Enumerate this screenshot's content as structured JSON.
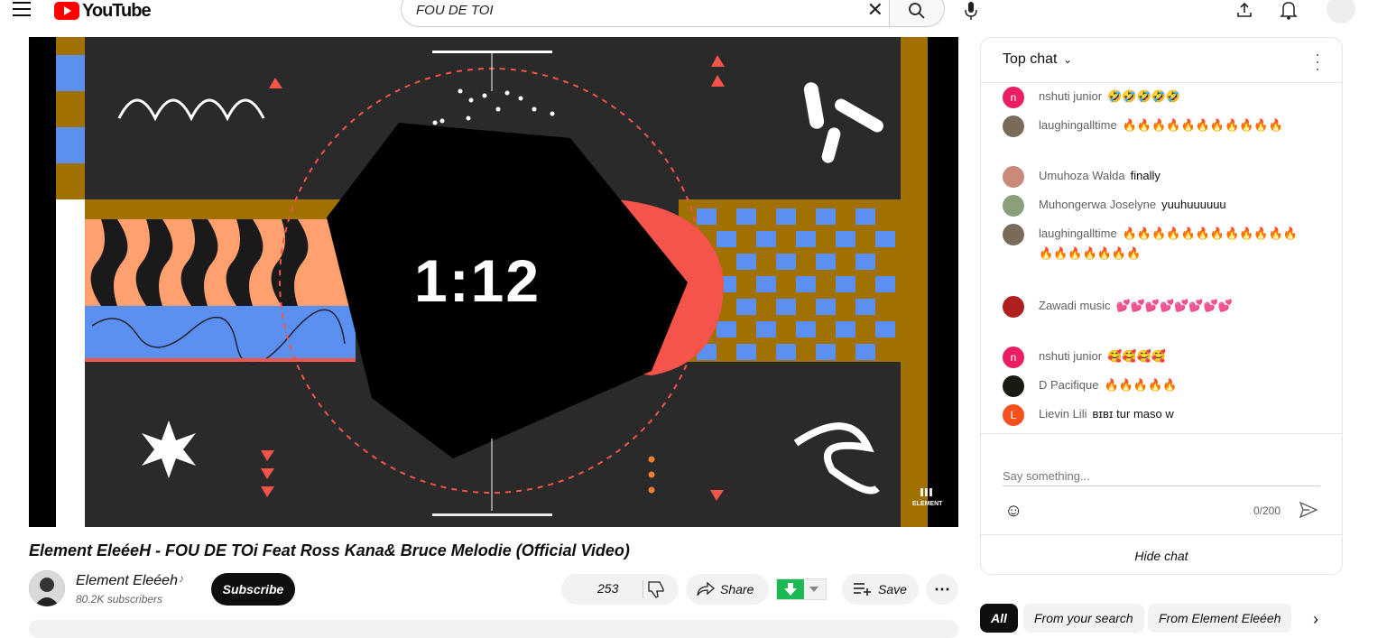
{
  "header": {
    "logo_text": "YouTube",
    "search_value": "FOU DE TOI"
  },
  "video": {
    "overlay_time": "1:12",
    "watermark": "ELEMENT",
    "title": "Element EleéeH - FOU DE TOi Feat Ross Kana& Bruce Melodie (Official Video)"
  },
  "channel": {
    "name": "Element Eleéeh",
    "subscribers": "80.2K subscribers",
    "subscribe_label": "Subscribe"
  },
  "actions": {
    "like_count": "253",
    "share_label": "Share",
    "save_label": "Save"
  },
  "chat": {
    "mode_label": "Top chat",
    "messages": [
      {
        "author": "nshuti junior",
        "text": "🤣🤣🤣🤣🤣",
        "avatar": "n",
        "color": "#e91e63"
      },
      {
        "author": "laughingalltime",
        "text": "🔥🔥🔥🔥🔥🔥🔥🔥🔥🔥🔥",
        "avatar": "",
        "color": "#7a6a5a"
      },
      {
        "author": "Umuhoza Walda",
        "text": "finally",
        "avatar": "",
        "color": "#c98a7a"
      },
      {
        "author": "Muhongerwa Joselyne",
        "text": "yuuhuuuuuu",
        "avatar": "",
        "color": "#8aa07a"
      },
      {
        "author": "laughingalltime",
        "text": "🔥🔥🔥🔥🔥🔥🔥🔥🔥🔥🔥🔥🔥🔥🔥🔥🔥🔥🔥",
        "avatar": "",
        "color": "#7a6a5a"
      },
      {
        "author": "Zawadi music",
        "text": "💕💕💕💕💕💕💕💕",
        "avatar": "",
        "color": "#b02020"
      },
      {
        "author": "nshuti junior",
        "text": "🥰🥰🥰🥰",
        "avatar": "n",
        "color": "#e91e63"
      },
      {
        "author": "D Pacifique",
        "text": "🔥🔥🔥🔥🔥",
        "avatar": "",
        "color": "#1a1a10"
      },
      {
        "author": "Lievin Lili",
        "text": "ʙɪʙɪ tur maso w",
        "avatar": "L",
        "color": "#f4511e"
      }
    ],
    "input_placeholder": "Say something...",
    "char_counter": "0/200",
    "hide_label": "Hide chat"
  },
  "chips": [
    "All",
    "From your search",
    "From Element Eleéeh"
  ],
  "colors": {
    "brand_red": "#ff0000",
    "video_bg": "#2a2a2a",
    "coral": "#f4544a",
    "gold": "#a07000",
    "blue": "#5b8ff0",
    "peach": "#ffa06e"
  }
}
